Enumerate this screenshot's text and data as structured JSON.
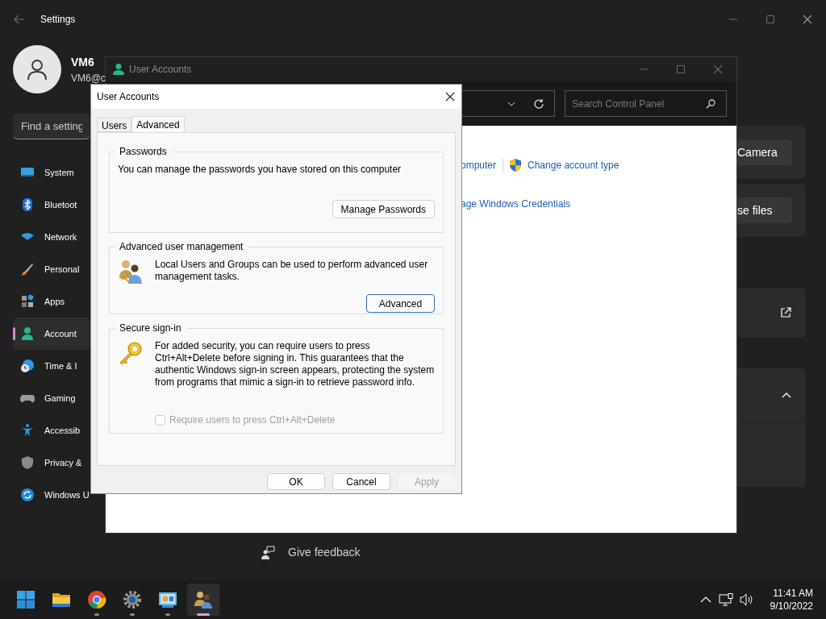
{
  "settings": {
    "title": "Settings",
    "user": {
      "name": "VM6",
      "email": "VM6@c"
    },
    "search": {
      "placeholder": "Find a setting"
    },
    "nav": [
      {
        "label": "System",
        "kind": "system",
        "selected": false
      },
      {
        "label": "Bluetoot",
        "kind": "bluetooth",
        "selected": false
      },
      {
        "label": "Network",
        "kind": "wifi",
        "selected": false
      },
      {
        "label": "Personal",
        "kind": "brush",
        "selected": false
      },
      {
        "label": "Apps",
        "kind": "apps",
        "selected": false
      },
      {
        "label": "Account",
        "kind": "person",
        "selected": true
      },
      {
        "label": "Time & I",
        "kind": "clock",
        "selected": false
      },
      {
        "label": "Gaming",
        "kind": "gamepad",
        "selected": false
      },
      {
        "label": "Accessib",
        "kind": "accessibility",
        "selected": false
      },
      {
        "label": "Privacy &",
        "kind": "shield",
        "selected": false
      },
      {
        "label": "Windows U",
        "kind": "update",
        "selected": false
      }
    ],
    "cards": [
      {
        "kind": "button",
        "label": "Camera"
      },
      {
        "kind": "button",
        "label": "se files"
      },
      {
        "kind": "link"
      },
      {
        "kind": "expand"
      },
      {
        "kind": "blank"
      }
    ],
    "feedback": "Give feedback"
  },
  "control_panel": {
    "title": "User Accounts",
    "search": {
      "placeholder": "Search Control Panel"
    },
    "rows": [
      {
        "links": [
          {
            "label": "omputer",
            "shield": false
          },
          {
            "label": "Change account type",
            "shield": true
          }
        ]
      },
      {
        "links": [
          {
            "label": "age Windows Credentials",
            "shield": false
          }
        ]
      }
    ]
  },
  "dialog": {
    "title": "User Accounts",
    "tabs": [
      {
        "label": "Users",
        "selected": false
      },
      {
        "label": "Advanced",
        "selected": true
      }
    ],
    "groups": [
      {
        "title": "Passwords",
        "kind": "none",
        "text": "You can manage the passwords you have stored on this computer",
        "button": {
          "label": "Manage Passwords",
          "default": false
        }
      },
      {
        "title": "Advanced user management",
        "kind": "users",
        "text": "Local Users and Groups can be used to perform advanced user management tasks.",
        "button": {
          "label": "Advanced",
          "default": true
        }
      },
      {
        "title": "Secure sign-in",
        "kind": "key",
        "text": "For added security, you can require users to press Ctrl+Alt+Delete before signing in. This guarantees that the authentic Windows sign-in screen appears, protecting the system from programs that mimic a sign-in to retrieve password info.",
        "checkbox": {
          "label": "Require users to press Ctrl+Alt+Delete",
          "checked": false,
          "disabled": true
        }
      }
    ],
    "buttons": [
      {
        "label": "OK",
        "disabled": false
      },
      {
        "label": "Cancel",
        "disabled": false
      },
      {
        "label": "Apply",
        "disabled": true
      }
    ]
  },
  "taskbar": {
    "apps": [
      {
        "kind": "start",
        "running": false,
        "active": false
      },
      {
        "kind": "folder",
        "running": false,
        "active": false
      },
      {
        "kind": "browser",
        "running": true,
        "active": false
      },
      {
        "kind": "gear",
        "running": true,
        "active": false
      },
      {
        "kind": "control",
        "running": true,
        "active": false
      },
      {
        "kind": "users",
        "running": true,
        "active": true
      }
    ],
    "time": "11:41 AM",
    "date": "9/10/2022"
  }
}
